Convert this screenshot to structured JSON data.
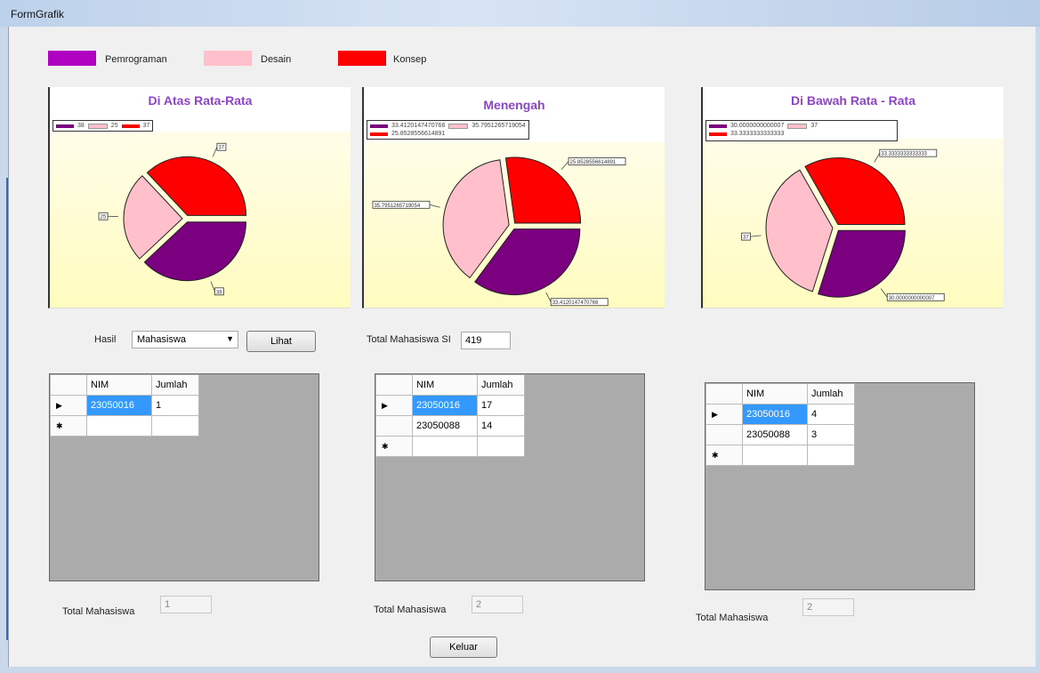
{
  "window": {
    "title": "FormGrafik"
  },
  "legend": [
    {
      "label": "Pemrograman",
      "color": "#b000c0"
    },
    {
      "label": "Desain",
      "color": "#ffc0cb"
    },
    {
      "label": "Konsep",
      "color": "#ff0000"
    }
  ],
  "colors": {
    "pemrograman": "#7b0080",
    "desain": "#ffc0cb",
    "konsep": "#ff0000"
  },
  "chart_data": [
    {
      "type": "pie",
      "title": "Di Atas Rata-Rata",
      "categories": [
        "Pemrograman",
        "Desain",
        "Konsep"
      ],
      "values": [
        38,
        25,
        37
      ],
      "legend_labels": [
        "38",
        "25",
        "37"
      ]
    },
    {
      "type": "pie",
      "title": "Menengah",
      "categories": [
        "Pemrograman",
        "Desain",
        "Konsep"
      ],
      "values": [
        33.41,
        35.8,
        25.86
      ],
      "legend_labels": [
        "33.4120147470766",
        "35.7951265719054",
        "25.8528556614891"
      ]
    },
    {
      "type": "pie",
      "title": "Di Bawah Rata - Rata",
      "categories": [
        "Pemrograman",
        "Desain",
        "Konsep"
      ],
      "values": [
        30,
        37,
        33.33
      ],
      "legend_labels": [
        "30.0000000000007",
        "37",
        "33.3333333333333"
      ]
    }
  ],
  "controls": {
    "hasil_label": "Hasil",
    "hasil_value": "Mahasiswa",
    "lihat_label": "Lihat",
    "total_si_label": "Total Mahasiswa SI",
    "total_si_value": "419",
    "keluar_label": "Keluar"
  },
  "grids": [
    {
      "headers": [
        "NIM",
        "Jumlah"
      ],
      "rows": [
        [
          "23050016",
          "1"
        ]
      ],
      "total_label": "Total Mahasiswa",
      "total_value": "1"
    },
    {
      "headers": [
        "NIM",
        "Jumlah"
      ],
      "rows": [
        [
          "23050016",
          "17"
        ],
        [
          "23050088",
          "14"
        ]
      ],
      "total_label": "Total Mahasiswa",
      "total_value": "2"
    },
    {
      "headers": [
        "NIM",
        "Jumlah"
      ],
      "rows": [
        [
          "23050016",
          "4"
        ],
        [
          "23050088",
          "3"
        ]
      ],
      "total_label": "Total Mahasiswa",
      "total_value": "2"
    }
  ]
}
